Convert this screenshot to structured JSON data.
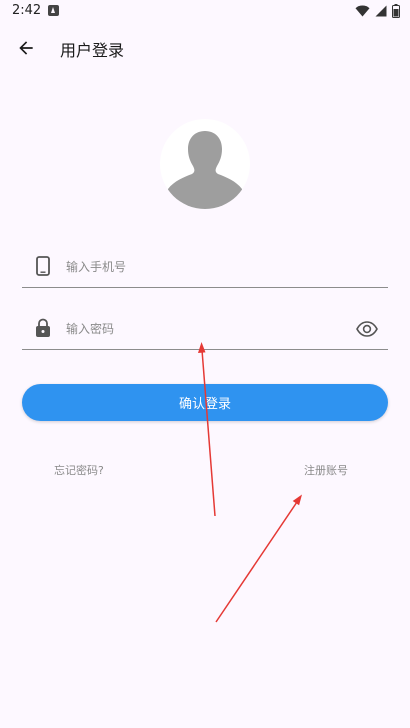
{
  "status_bar": {
    "time": "2:42",
    "icons": [
      "notification-icon",
      "wifi-icon",
      "signal-icon",
      "battery-icon"
    ]
  },
  "header": {
    "title": "用户登录",
    "back_icon": "arrow-back-icon"
  },
  "avatar": {
    "icon": "default-avatar-icon"
  },
  "form": {
    "phone": {
      "placeholder": "输入手机号",
      "value": "",
      "icon": "phone-icon"
    },
    "password": {
      "placeholder": "输入密码",
      "value": "",
      "icon": "lock-icon",
      "toggle_icon": "eye-icon"
    },
    "submit_label": "确认登录"
  },
  "links": {
    "forgot_password": "忘记密码?",
    "register": "注册账号"
  },
  "colors": {
    "background": "#fdf8ff",
    "primary": "#2f93f0",
    "annotation": "#e53935",
    "placeholder": "#8a8a8a"
  }
}
